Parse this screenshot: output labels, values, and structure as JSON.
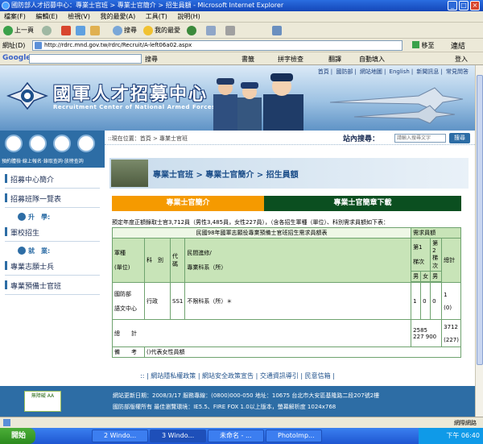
{
  "window": {
    "title": "國防部人才招募中心：專業士官班 > 專業士官簡介 > 招生員額 - Microsoft Internet Explorer"
  },
  "menubar": [
    "檔案(F)",
    "編輯(E)",
    "檢視(V)",
    "我的最愛(A)",
    "工具(T)",
    "說明(H)"
  ],
  "toolbar": {
    "back": "上一頁",
    "search": "搜尋",
    "favorites": "我的最愛"
  },
  "address": {
    "label": "網址(D)",
    "url": "http://rdrc.mnd.gov.tw/rdrc/Recruit/A-left06a02.aspx",
    "go": "移至",
    "links": "連結"
  },
  "googlebar": {
    "logo": "Google",
    "search_btn": "搜尋",
    "bookmarks": "書籤",
    "spell": "拼字檢查",
    "translate": "翻譯",
    "autofill": "自動填入",
    "login": "登入"
  },
  "site": {
    "top_links": [
      "首頁",
      "國防部",
      "網站地圖",
      "English",
      "新聞訊息",
      "常見問答"
    ],
    "title": "國軍人才招募中心",
    "subtitle": "Recruitment Center of National Armed Forces",
    "quick_caption": "預約體檢‧線上報名‧錄取查詢‧放榜查詢"
  },
  "nav": {
    "items": [
      "招募中心簡介",
      "招募班隊一覽表",
      "軍校招生",
      "專業志願士兵",
      "專業預備士官班"
    ],
    "sub_promotion": "升　學:",
    "sub_employment": "就　業:"
  },
  "breadcrumb": "::現在位置：首頁 > 專業士官班",
  "search": {
    "label": "站內搜尋：",
    "placeholder": "請輸入搜尋文字",
    "button": "搜尋"
  },
  "banner_title": "專業士官班 > 專業士官簡介 > 招生員額",
  "tabs": {
    "intro": "專業士官簡介",
    "download": "專業士官簡章下載"
  },
  "intro_text": "預定年度正額錄取士官3,712員（男性3,485員，女性227員），（含各招生軍種（單位）、科別需求員額如下表：",
  "table": {
    "caption": "民國98年國軍志願役專業預備士官班招生需求員額表",
    "headers": {
      "branch": "軍種",
      "unit": "(單位)",
      "subject": "科　別",
      "code": "代碼",
      "school": "民間進修/",
      "dept": "專業科系（所）",
      "demand": "需求員額",
      "first": "第1",
      "term": "梯次",
      "second": "第2",
      "term2": "梯次",
      "total": "總計",
      "male": "男",
      "female": "女",
      "male2": "男"
    },
    "row": {
      "branch1": "國防部",
      "branch2": "語文中心",
      "subject": "行政",
      "code": "SS1",
      "dept": "不限科系（所）＊",
      "m1": "1",
      "f1": "0",
      "m2": "0",
      "total": "1",
      "total_f": "(0)"
    },
    "sum": {
      "label": "總　　計",
      "values": "2585 227 900",
      "total": "3712",
      "total_f": "(227)"
    },
    "note_label": "備　　考",
    "note": "()代表女性員額"
  },
  "footer": {
    "links": ":: | 網站隱私權政策 | 網站安全政策宣告 | 交通資訊導引 | 民意信箱 |",
    "badge": "無障礙 AA",
    "line1": "網站更新日期：2008/3/17  服務專線：(0800)000-050  地址：10675 台北市大安區基隆路二段207號2樓",
    "line2": "國防部版權所有 最佳瀏覽環境：IE5.5、FIRE FOX 1.0以上版本，螢幕解析度 1024x768"
  },
  "status": {
    "zone": "網際網路"
  },
  "taskbar": {
    "start": "開始",
    "tasks": [
      "2 Windo...",
      "3 Windo...",
      "未命名 - ...",
      "PhotoImp..."
    ],
    "clock": "下午 06:40"
  }
}
